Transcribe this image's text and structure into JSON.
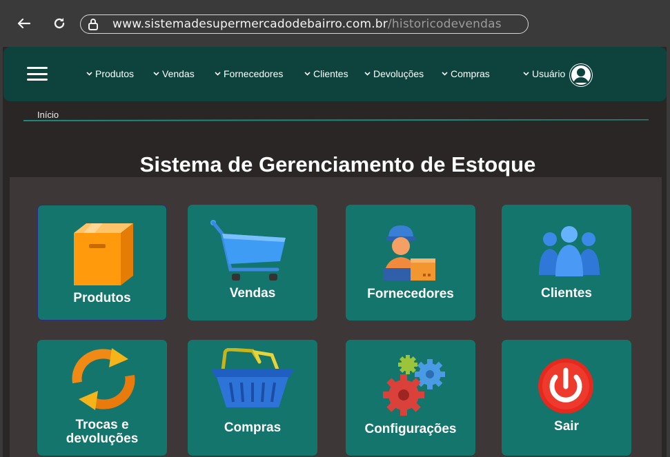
{
  "browser": {
    "url_domain": "www.sistemadesupermercadodebairro.com.br",
    "url_path": "/historicodevendas"
  },
  "header": {
    "menu": [
      "Produtos",
      "Vendas",
      "Fornecedores",
      "Clientes",
      "Devoluções",
      "Compras"
    ],
    "user_label": "Usuário"
  },
  "breadcrumb": "Início",
  "page_title": "Sistema de Gerenciamento de Estoque",
  "tiles": [
    {
      "label": "Produtos",
      "icon": "box-icon"
    },
    {
      "label": "Vendas",
      "icon": "shopping-cart-icon"
    },
    {
      "label": "Fornecedores",
      "icon": "delivery-person-icon"
    },
    {
      "label": "Clientes",
      "icon": "users-group-icon"
    },
    {
      "label": "Trocas e\ndevoluções",
      "icon": "exchange-arrows-icon"
    },
    {
      "label": "Compras",
      "icon": "shopping-basket-icon"
    },
    {
      "label": "Configurações",
      "icon": "gears-icon"
    },
    {
      "label": "Sair",
      "icon": "power-icon"
    }
  ],
  "colors": {
    "header_bg": "#0e433d",
    "tile_bg": "#13756b",
    "page_bg": "#2b2626",
    "panel_bg": "#3d3837"
  }
}
